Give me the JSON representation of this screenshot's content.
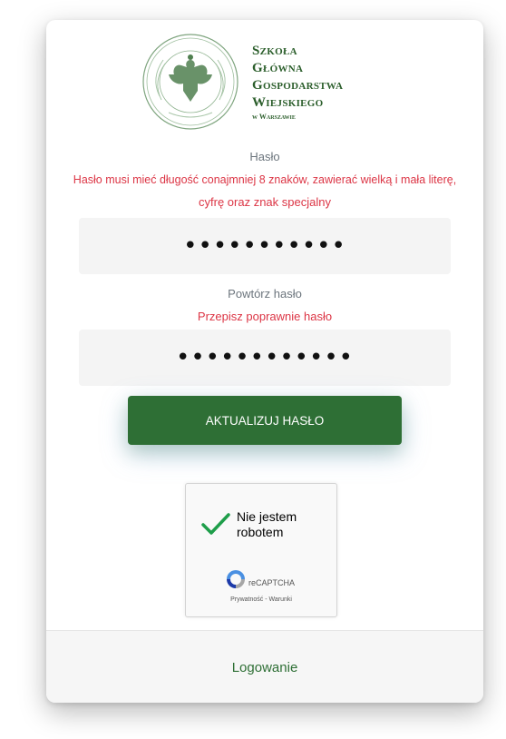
{
  "logo": {
    "line1": "Szkoła Główna",
    "line2": "Gospodarstwa",
    "line3": "Wiejskiego",
    "line4": "w Warszawie"
  },
  "form": {
    "password_label": "Hasło",
    "password_error_line1": "Hasło musi mieć długość conajmniej 8 znaków, zawierać wielką i mała literę,",
    "password_error_line2": "cyfrę oraz znak specjalny",
    "password_value": "•••••••••••",
    "repeat_label": "Powtórz hasło",
    "repeat_error": "Przepisz poprawnie hasło",
    "repeat_value": "••••••••••••",
    "submit_label": "AKTUALIZUJ HASŁO"
  },
  "captcha": {
    "label": "Nie jestem robotem",
    "brand": "reCAPTCHA",
    "privacy": "Prywatność",
    "separator": " - ",
    "terms": "Warunki"
  },
  "footer": {
    "login_link": "Logowanie"
  },
  "colors": {
    "brand_green": "#2e6f35",
    "error_red": "#dc3545"
  }
}
